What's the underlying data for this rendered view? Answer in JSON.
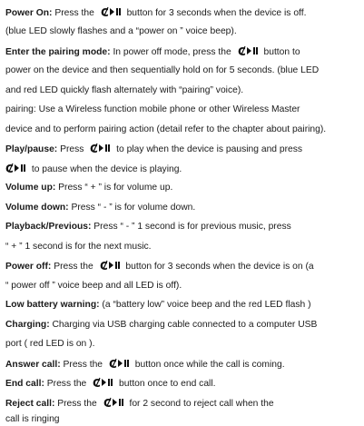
{
  "icon_name": "phone-play-pause-icon",
  "lines": [
    {
      "label": "Power On:",
      "a": " Press the ",
      "b": " button for 3 seconds when the device is off."
    },
    {
      "a": "(blue LED slowly flashes and a “power on ” voice beep)."
    },
    {
      "label": "Enter the pairing mode:",
      "a": " In power off mode, press the ",
      "b": " button to"
    },
    {
      "a": "power on the device and then sequentially hold on for 5 seconds. (blue LED"
    },
    {
      "a": "and red LED quickly flash alternately with “pairing” voice)."
    },
    {
      "a": "pairing: Use a Wireless function mobile phone or other Wireless Master"
    },
    {
      "a": "device and to perform pairing action (detail refer to the chapter about pairing)."
    },
    {
      "label": "Play/pause:",
      "a": " Press ",
      "b": " to play when the device is pausing and press"
    },
    {
      "a": "",
      "b": " to pause when the device is playing."
    },
    {
      "label": "Volume up:",
      "a": " Press “ + ” is for volume up."
    },
    {
      "label": "Volume down:",
      "a": " Press “ - ” is for volume down."
    },
    {
      "label": "Playback/Previous:",
      "a": " Press “ - ”  1 second is for previous music, press"
    },
    {
      "a": "“ + ” 1 second is for the next music."
    },
    {
      "label": "Power off:",
      "a": " Press the ",
      "b": " button for 3 seconds when the device is on (a"
    },
    {
      "a": "“  power off ” voice beep and all LED is off)."
    },
    {
      "label": "Low battery warning:",
      "a": " (a “battery low” voice beep and the red LED flash )"
    },
    {
      "label": "Charging:",
      "a": " Charging via USB charging cable connected to a computer USB"
    },
    {
      "a": "port ( red LED is on )."
    },
    {
      "label": "Answer call:",
      "a": " Press the ",
      "b": " button once while the call is coming."
    },
    {
      "label": "End call:",
      "a": " Press the ",
      "b": " button once to end call."
    },
    {
      "label": "Reject call:",
      "a": "   Press the ",
      "b": " for 2 second to reject call when the"
    },
    {
      "a": "call is ringing"
    }
  ]
}
